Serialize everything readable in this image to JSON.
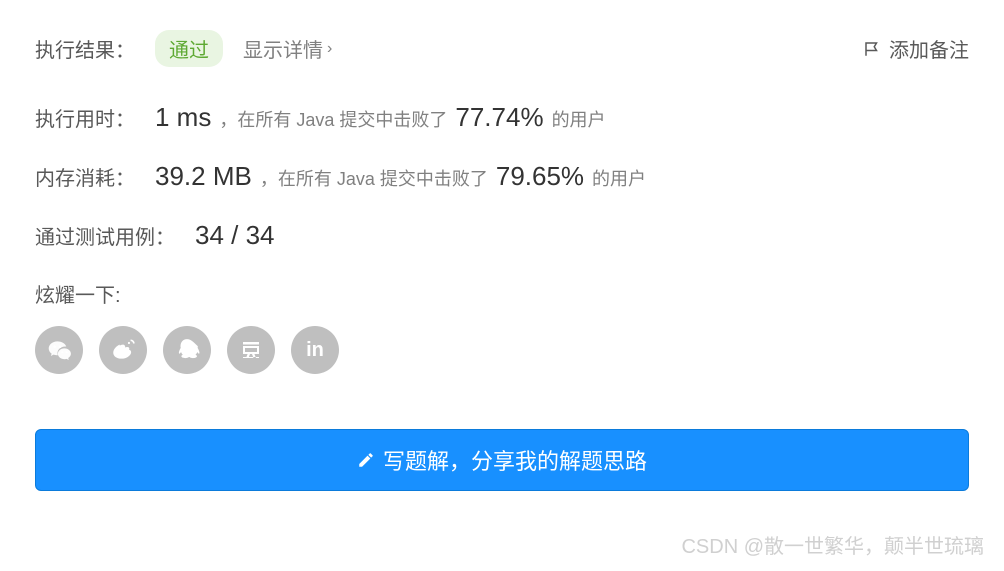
{
  "header": {
    "result_label": "执行结果：",
    "status": "通过",
    "show_details": "显示详情",
    "add_note": "添加备注"
  },
  "runtime": {
    "label": "执行用时：",
    "value": "1 ms",
    "prefix": "，在所有 Java 提交中击败了",
    "percent": "77.74%",
    "suffix": "的用户"
  },
  "memory": {
    "label": "内存消耗：",
    "value": "39.2 MB",
    "prefix": "，在所有 Java 提交中击败了",
    "percent": "79.65%",
    "suffix": "的用户"
  },
  "testcases": {
    "label": "通过测试用例：",
    "value": "34 / 34"
  },
  "share": {
    "label": "炫耀一下:"
  },
  "action": {
    "write_solution": "写题解，分享我的解题思路"
  },
  "watermark": "CSDN @散一世繁华，颠半世琉璃"
}
